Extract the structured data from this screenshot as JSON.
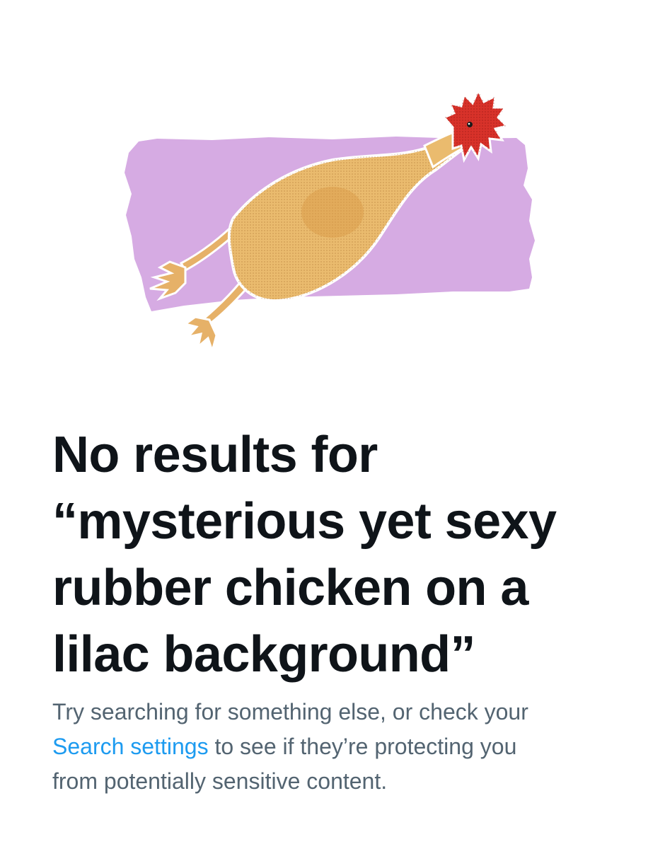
{
  "illustration": {
    "description_icon": "rubber-chicken-illustration",
    "background_color": "#d6abe3",
    "chicken_body_color": "#e8b86a",
    "chicken_comb_color": "#d8322a"
  },
  "empty_state": {
    "headline_lines": [
      "No results for",
      "“mysterious yet sexy",
      "rubber chicken on a",
      "lilac background”"
    ],
    "subtext": {
      "line1": "Try searching for something else, or check your",
      "link_text": "Search settings",
      "line2_rest": " to see if they’re protecting you",
      "line3": "from potentially sensitive content."
    }
  },
  "colors": {
    "text_primary": "#0f1419",
    "text_secondary": "#536471",
    "link": "#1d9bf0"
  }
}
